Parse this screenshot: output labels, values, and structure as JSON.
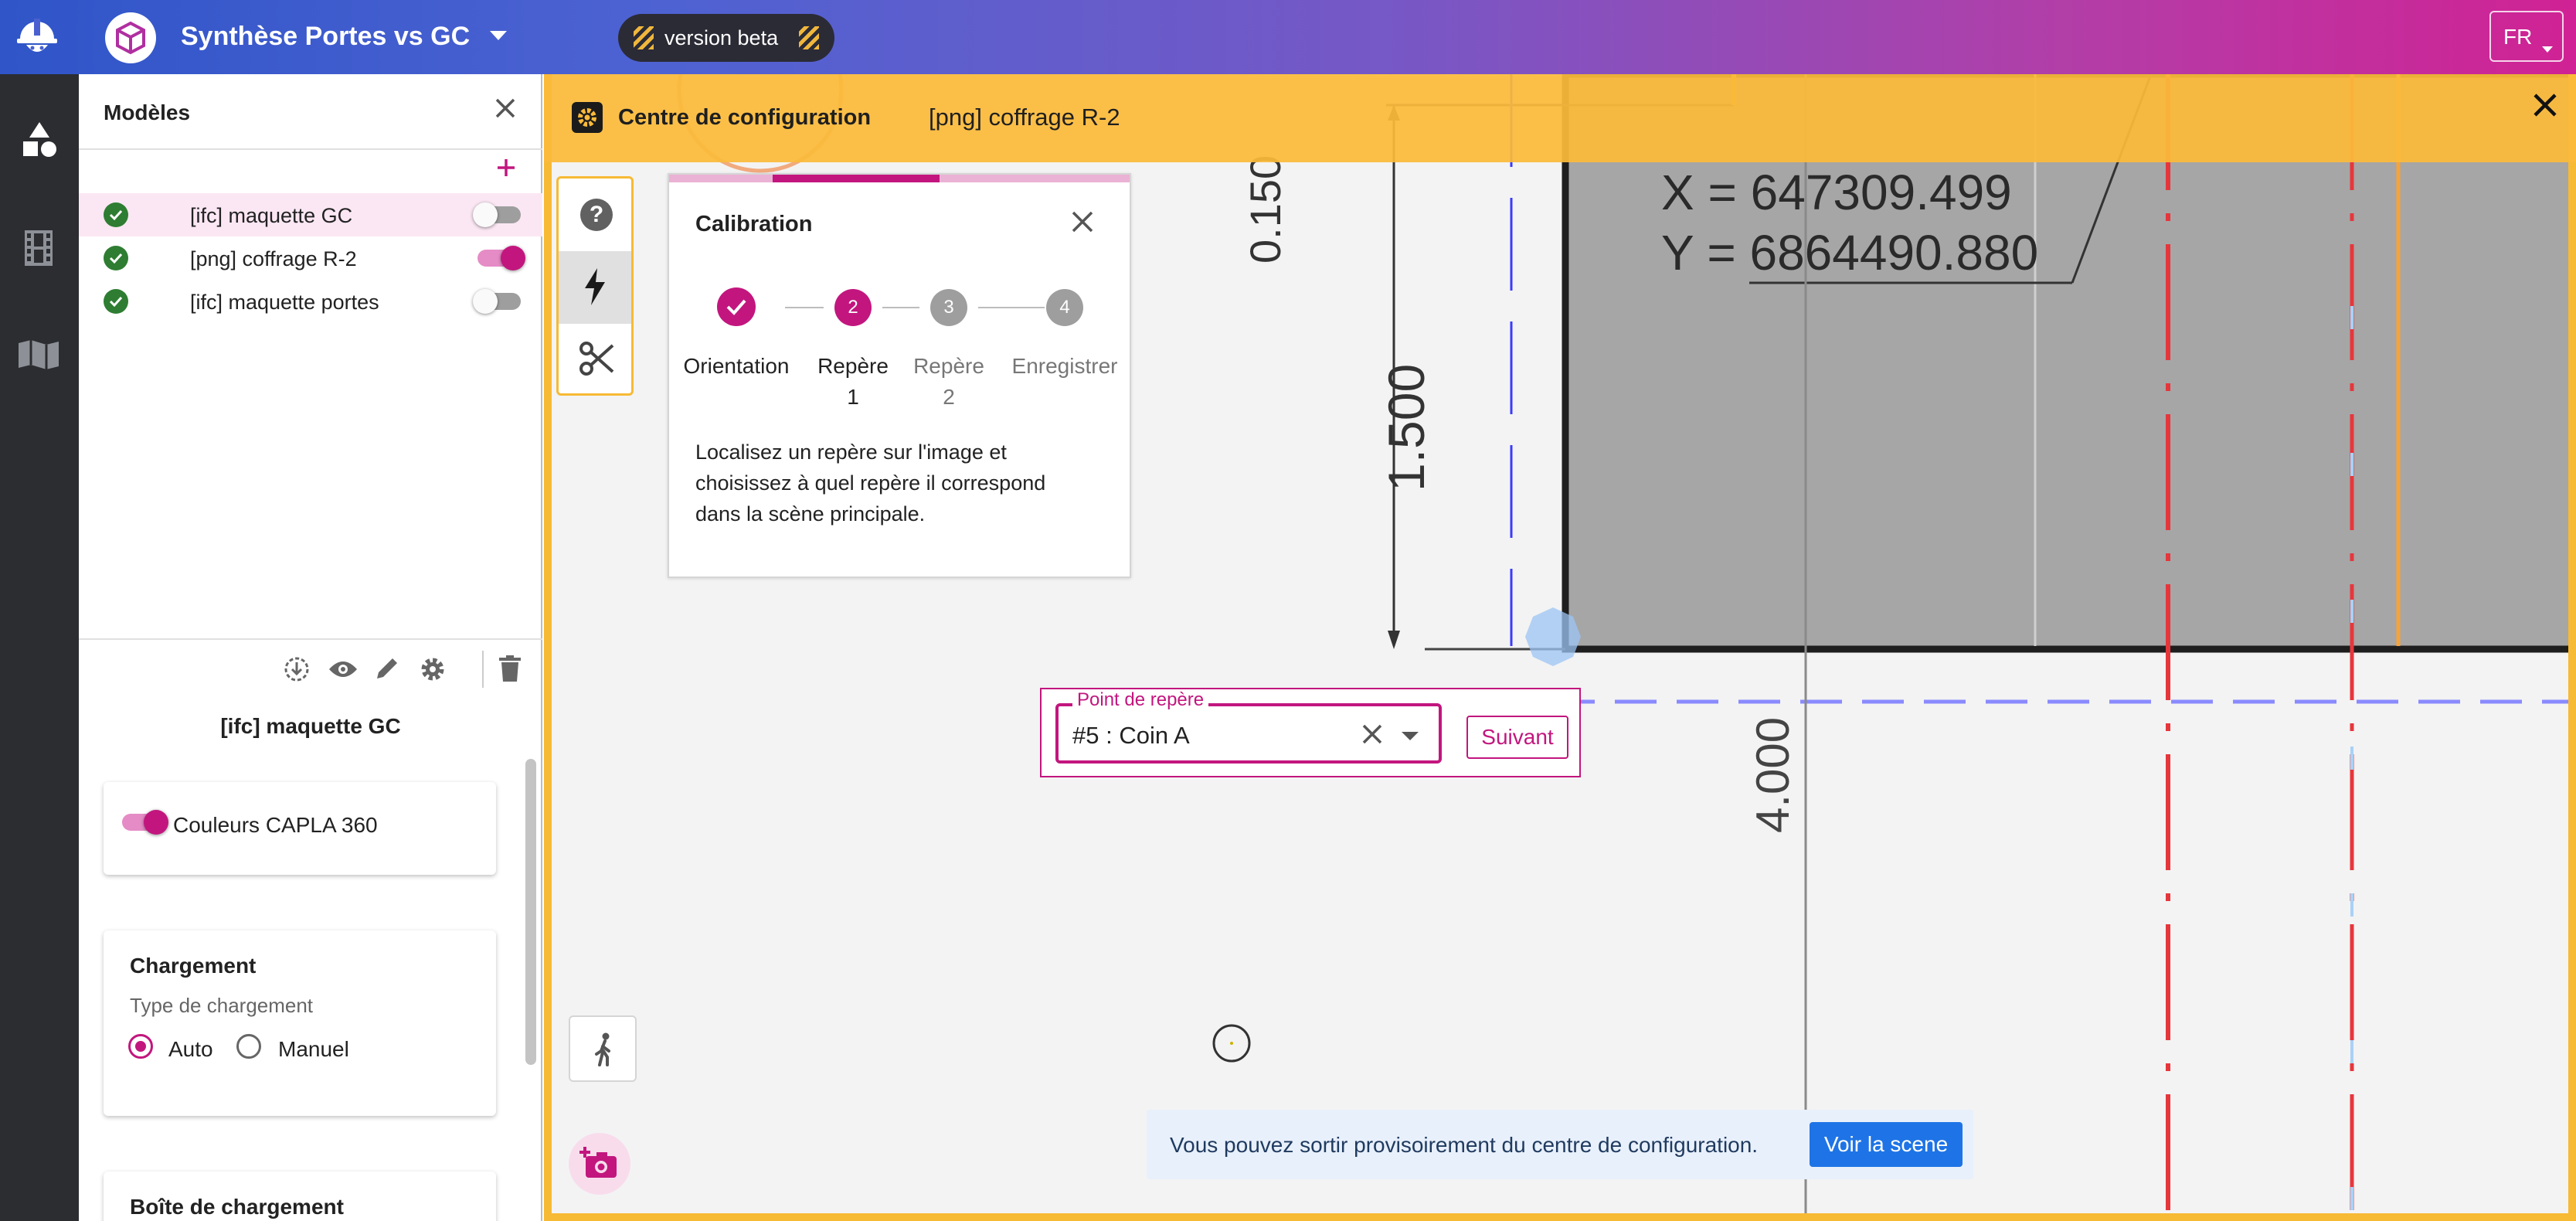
{
  "app": {
    "project_title": "Synthèse Portes vs GC",
    "beta_label": "version beta",
    "language": "FR"
  },
  "models_panel": {
    "title": "Modèles",
    "models": [
      {
        "name": "[ifc] maquette GC",
        "enabled": false,
        "selected": true
      },
      {
        "name": "[png] coffrage R-2",
        "enabled": true,
        "selected": false
      },
      {
        "name": "[ifc] maquette portes",
        "enabled": false,
        "selected": false
      }
    ],
    "selected_model_title": "[ifc] maquette GC",
    "colors_toggle_label": "Couleurs CAPLA 360",
    "loading": {
      "title": "Chargement",
      "type_label": "Type de chargement",
      "options": [
        "Auto",
        "Manuel"
      ],
      "selected": "Auto"
    },
    "box_title": "Boîte de chargement"
  },
  "config_center": {
    "title": "Centre de configuration",
    "image_name": "[png] coffrage R-2"
  },
  "calibration": {
    "title": "Calibration",
    "steps": [
      {
        "number": "1",
        "label": "Orientation",
        "sub": "",
        "state": "done"
      },
      {
        "number": "2",
        "label": "Repère",
        "sub": "1",
        "state": "active"
      },
      {
        "number": "3",
        "label": "Repère",
        "sub": "2",
        "state": "todo"
      },
      {
        "number": "4",
        "label": "Enregistrer",
        "sub": "",
        "state": "todo"
      }
    ],
    "help_line1": "Localisez un repère sur l'image et",
    "help_line2": "choisissez à quel repère il correspond",
    "help_line3": "dans la scène principale."
  },
  "landmark_picker": {
    "legend": "Point de repère",
    "value": "#5 : Coin A",
    "next_label": "Suivant"
  },
  "drawing": {
    "coord_x": "X = 647309.499",
    "coord_y": "Y = 6864490.880",
    "dim_top": "0.150",
    "dim_vertical": "1.500",
    "dim_lower": "4.000"
  },
  "notice": {
    "text": "Vous pouvez sortir provisoirement du centre de configuration.",
    "button_label": "Voir la scene"
  },
  "colors": {
    "accent": "#c2167e",
    "config_bar": "#fbba3a",
    "success": "#2e7d32",
    "info_button": "#1e74e6"
  },
  "icons": [
    "helmet-logo-icon",
    "cube-logo-icon",
    "shapes-icon",
    "film-icon",
    "map-icon",
    "close-icon",
    "add-icon",
    "import-icon",
    "eye-icon",
    "pencil-icon",
    "gear-icon",
    "trash-icon",
    "help-icon",
    "bolt-icon",
    "scissors-icon",
    "pedestrian-icon",
    "camera-add-icon",
    "chevron-down-icon",
    "clear-icon"
  ]
}
